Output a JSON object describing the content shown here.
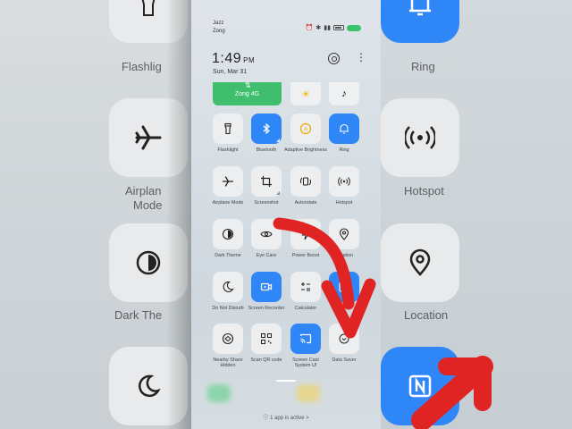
{
  "bg_left": {
    "labels": [
      "Flashlig",
      "Airplan",
      "Mode",
      "Dark The"
    ]
  },
  "bg_right": {
    "labels": [
      "Ring",
      "Hotspot",
      "Location"
    ]
  },
  "status_bar": {
    "carrier1": "Jazz",
    "carrier2": "Zong"
  },
  "header": {
    "time": "1:49",
    "ampm": "PM",
    "date": "Sun, Mar 31"
  },
  "quick_row": {
    "zong_label": "Zong 4G"
  },
  "tiles": [
    {
      "label": "Flashlight",
      "icon": "flashlight-icon",
      "active": false
    },
    {
      "label": "Bluetooth",
      "icon": "bluetooth-icon",
      "active": true
    },
    {
      "label": "Adaptive Brightness",
      "icon": "brightness-icon",
      "active": false
    },
    {
      "label": "Ring",
      "icon": "bell-icon",
      "active": true
    },
    {
      "label": "Airplane Mode",
      "icon": "airplane-icon",
      "active": false
    },
    {
      "label": "Screenshot",
      "icon": "crop-icon",
      "active": false
    },
    {
      "label": "Autorotate",
      "icon": "rotate-icon",
      "active": false
    },
    {
      "label": "Hotspot",
      "icon": "hotspot-icon",
      "active": false
    },
    {
      "label": "Dark Theme",
      "icon": "dark-theme-icon",
      "active": false
    },
    {
      "label": "Eye Care",
      "icon": "eye-icon",
      "active": false
    },
    {
      "label": "Power Boost",
      "icon": "power-boost-icon",
      "active": false
    },
    {
      "label": "Location",
      "icon": "location-pin-icon",
      "active": false
    },
    {
      "label": "Do Not Disturb",
      "icon": "moon-icon",
      "active": false
    },
    {
      "label": "Screen Recorder",
      "icon": "video-camera-icon",
      "active": true
    },
    {
      "label": "Calculator",
      "icon": "calculator-icon",
      "active": false
    },
    {
      "label": "NFC",
      "icon": "nfc-icon",
      "active": true
    },
    {
      "label": "Nearby Share Hidden",
      "icon": "nearby-share-icon",
      "active": false
    },
    {
      "label": "Scan QR code",
      "icon": "qr-icon",
      "active": false
    },
    {
      "label": "Screen Cast System UI",
      "icon": "cast-icon",
      "active": true
    },
    {
      "label": "Data Saver",
      "icon": "data-saver-icon",
      "active": false
    }
  ],
  "footer": {
    "apps_active": "1 app is active >"
  },
  "colors": {
    "accent_blue": "#2f86f6",
    "accent_green": "#3fbf6e",
    "arrow_red": "#e02424"
  }
}
